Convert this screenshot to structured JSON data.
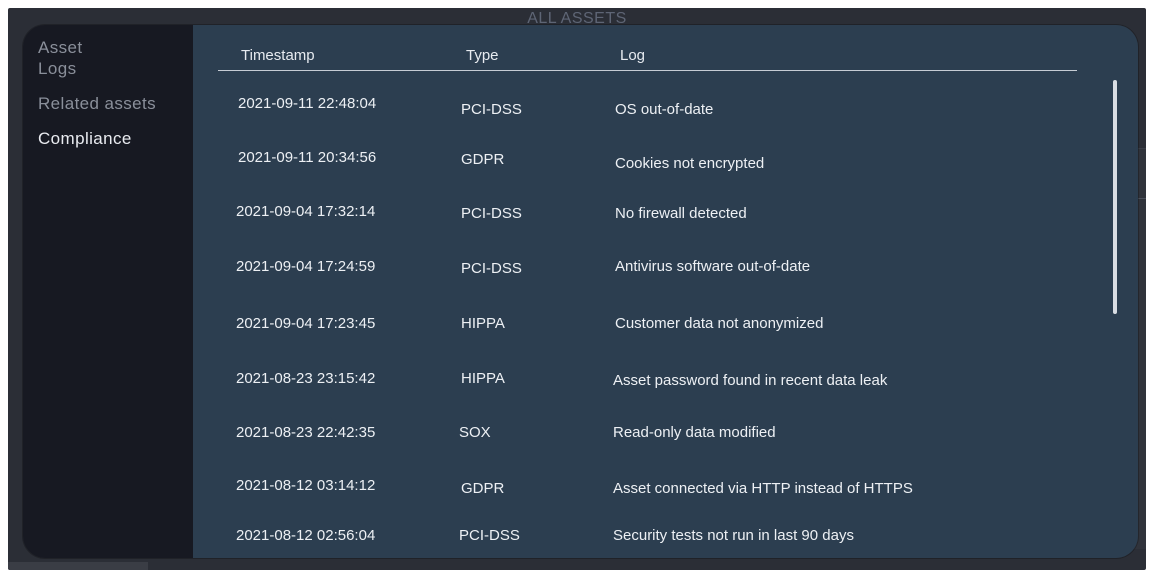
{
  "backdrop": {
    "title": "ALL ASSETS"
  },
  "sidebar": {
    "items": [
      {
        "label": "Asset",
        "active": false
      },
      {
        "label": "Logs",
        "active": false
      },
      {
        "label": "Related assets",
        "active": false
      },
      {
        "label": "Compliance",
        "active": true
      }
    ]
  },
  "table": {
    "columns": [
      "Timestamp",
      "Type",
      "Log"
    ],
    "rows": [
      {
        "timestamp": "2021-09-11 22:48:04",
        "type": "PCI-DSS",
        "log": "OS out-of-date"
      },
      {
        "timestamp": "2021-09-11 20:34:56",
        "type": "GDPR",
        "log": "Cookies not encrypted"
      },
      {
        "timestamp": "2021-09-04 17:32:14",
        "type": "PCI-DSS",
        "log": "No firewall detected"
      },
      {
        "timestamp": "2021-09-04 17:24:59",
        "type": "PCI-DSS",
        "log": "Antivirus software out-of-date"
      },
      {
        "timestamp": "2021-09-04 17:23:45",
        "type": "HIPPA",
        "log": "Customer data not anonymized"
      },
      {
        "timestamp": "2021-08-23 23:15:42",
        "type": "HIPPA",
        "log": "Asset password found in recent data leak"
      },
      {
        "timestamp": "2021-08-23 22:42:35",
        "type": "SOX",
        "log": "Read-only data modified"
      },
      {
        "timestamp": "2021-08-12 03:14:12",
        "type": "GDPR",
        "log": "Asset connected via HTTP instead of HTTPS"
      },
      {
        "timestamp": "2021-08-12 02:56:04",
        "type": "PCI-DSS",
        "log": "Security tests not run in last 90 days"
      }
    ]
  },
  "colors": {
    "sidebar_bg": "#171922",
    "content_bg": "#2c3e50",
    "backdrop_bg": "#2b2e36",
    "active_text": "#e9ebf0",
    "inactive_text": "#8a8f9a"
  }
}
